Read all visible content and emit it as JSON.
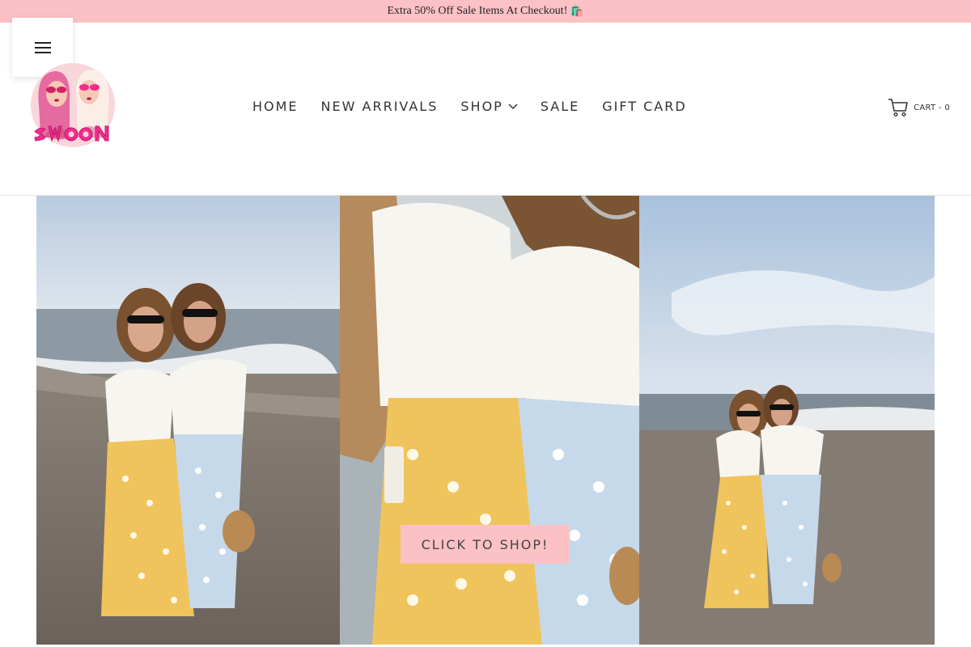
{
  "announcement": {
    "text": "Extra 50% Off Sale Items At Checkout!",
    "icon": "shopping-bags-icon",
    "icon_glyph": "🛍️"
  },
  "header": {
    "menu_icon": "hamburger-menu-icon",
    "logo": {
      "name": "swoon-logo",
      "text": "SWOON"
    },
    "nav": [
      {
        "label": "HOME"
      },
      {
        "label": "NEW ARRIVALS"
      },
      {
        "label": "SHOP",
        "has_dropdown": true
      },
      {
        "label": "SALE"
      },
      {
        "label": "GIFT CARD"
      }
    ],
    "cart": {
      "icon": "cart-icon",
      "label": "CART - 0"
    }
  },
  "hero": {
    "panels": [
      "beach-photo-wide",
      "beach-photo-closeup",
      "beach-photo-far"
    ],
    "cta_label": "CLICK TO SHOP!"
  },
  "colors": {
    "announcement_bg": "#fbc1c5",
    "cta_bg": "#fbc1c5",
    "logo_pink": "#f22c8e"
  }
}
